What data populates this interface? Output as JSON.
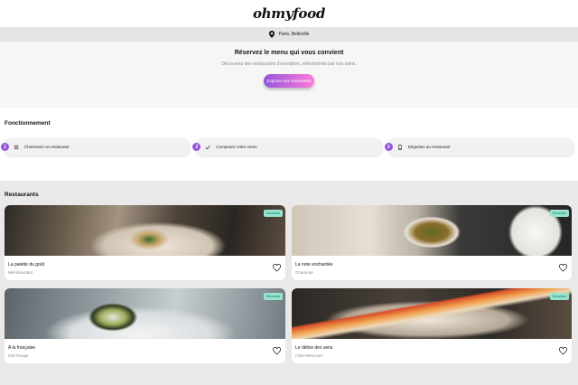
{
  "header": {
    "logo": "ohmyfood"
  },
  "location": {
    "text": "Paris, Belleville"
  },
  "hero": {
    "title": "Réservez le menu qui vous convient",
    "subtitle": "Découvrez des restaurants d'exception, sélectionnés par nos soins.",
    "button_label": "Explorer nos restaurants"
  },
  "how": {
    "title": "Fonctionnement",
    "steps": [
      {
        "num": "1",
        "label": "Choisissez un restaurant",
        "icon": "list-icon"
      },
      {
        "num": "2",
        "label": "Composez votre menu",
        "icon": "check-icon"
      },
      {
        "num": "3",
        "label": "Dégustez au restaurant",
        "icon": "phone-icon"
      }
    ]
  },
  "restaurants": {
    "title": "Restaurants",
    "badge": "Nouveau",
    "items": [
      {
        "name": "La palette du goût",
        "location": "Ménilmontant"
      },
      {
        "name": "La note enchantée",
        "location": "Charonne"
      },
      {
        "name": "A la française",
        "location": "Cité Rouge"
      },
      {
        "name": "Le délice des sens",
        "location": "Folie-Méricourt"
      }
    ]
  },
  "colors": {
    "accent": "#9356dc",
    "accent_end": "#ff79da",
    "badge_bg": "#99e2d0",
    "badge_text": "#08775c"
  }
}
